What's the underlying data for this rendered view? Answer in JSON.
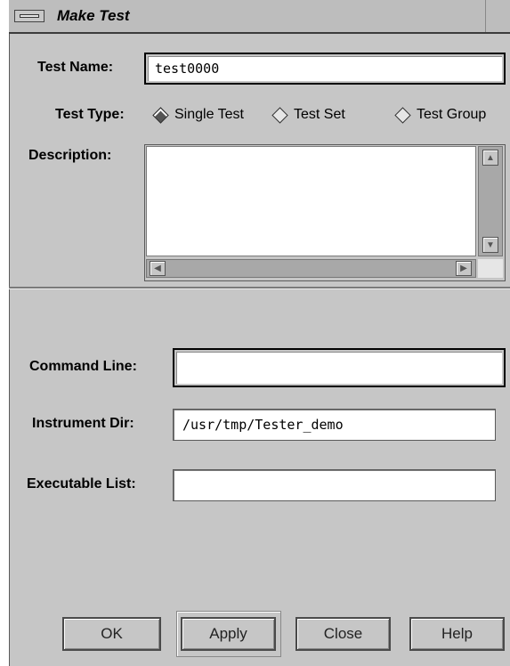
{
  "window": {
    "title": "Make Test"
  },
  "fields": {
    "test_name": {
      "label": "Test Name:",
      "value": "test0000"
    },
    "test_type": {
      "label": "Test Type:",
      "options": [
        "Single Test",
        "Test Set",
        "Test Group"
      ],
      "selected": "Single Test"
    },
    "description": {
      "label": "Description:",
      "value": ""
    },
    "command_line": {
      "label": "Command Line:",
      "value": ""
    },
    "instrument_dir": {
      "label": "Instrument Dir:",
      "value": "/usr/tmp/Tester_demo"
    },
    "executable_list": {
      "label": "Executable List:",
      "value": ""
    }
  },
  "buttons": {
    "ok": "OK",
    "apply": "Apply",
    "close": "Close",
    "help": "Help"
  },
  "icons": {
    "window_menu": "window-menu-icon",
    "scroll_up": "up-arrow-icon",
    "scroll_down": "down-arrow-icon",
    "scroll_left": "left-arrow-icon",
    "scroll_right": "right-arrow-icon",
    "radio": "diamond-radio-icon"
  }
}
